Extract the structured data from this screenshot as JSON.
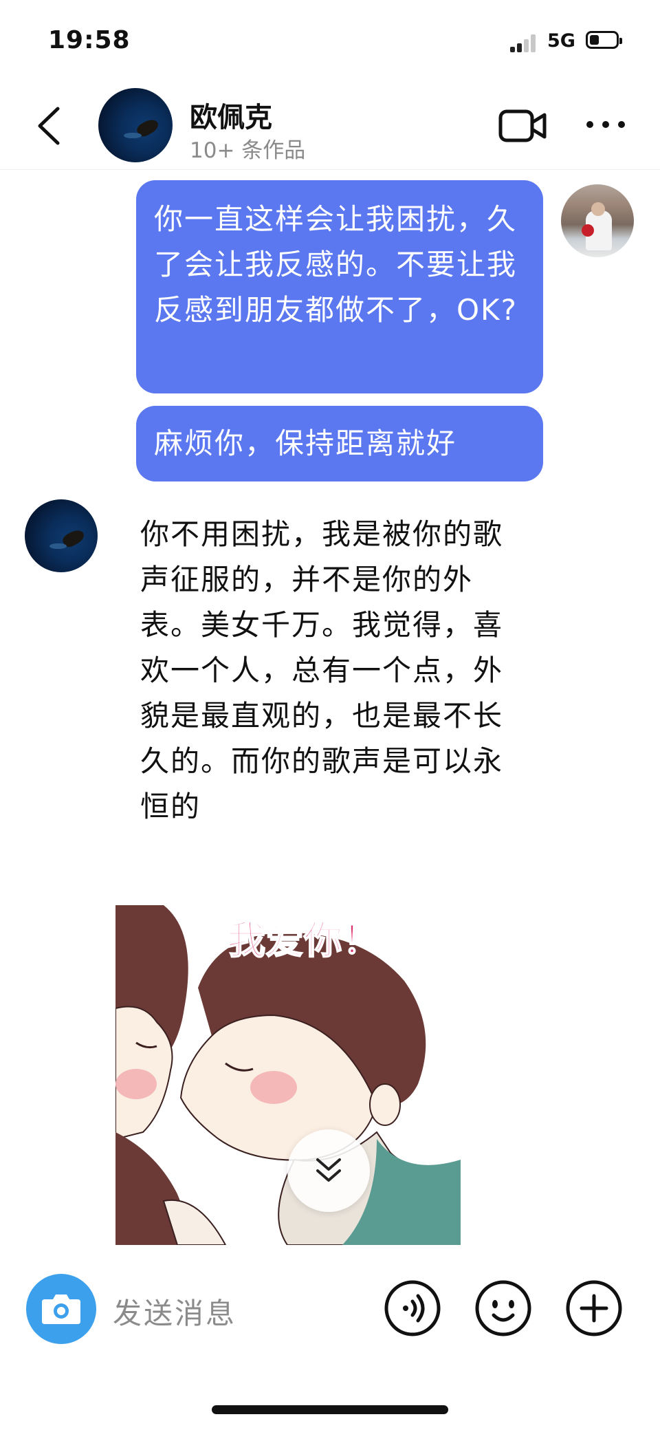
{
  "status_bar": {
    "time": "19:58",
    "network": "5G",
    "battery_percent": 25
  },
  "header": {
    "name": "欧佩克",
    "subtitle": "10+ 条作品",
    "back_icon": "chevron-left-icon",
    "video_icon": "video-camera-icon",
    "more_icon": "more-dots-icon"
  },
  "messages": [
    {
      "sender": "me",
      "text": "你一直这样会让我困扰，久了会让我反感的。不要让我反感到朋友都做不了，OK?"
    },
    {
      "sender": "me",
      "text": "麻烦你，保持距离就好"
    },
    {
      "sender": "them",
      "text": "你不用困扰，我是被你的歌声征服的，并不是你的外表。美女千万。我觉得，喜欢一个人，总有一个点，外貌是最直观的，也是最不长久的。而你的歌声是可以永恒的"
    },
    {
      "sender": "them",
      "sticker_text": "我爱你！"
    }
  ],
  "input_bar": {
    "placeholder": "发送消息",
    "camera_icon": "camera-icon",
    "voice_icon": "voice-icon",
    "emoji_icon": "emoji-icon",
    "plus_icon": "plus-icon"
  },
  "colors": {
    "accent_blue": "#5b78f0",
    "camera_blue": "#3ca0ec"
  }
}
